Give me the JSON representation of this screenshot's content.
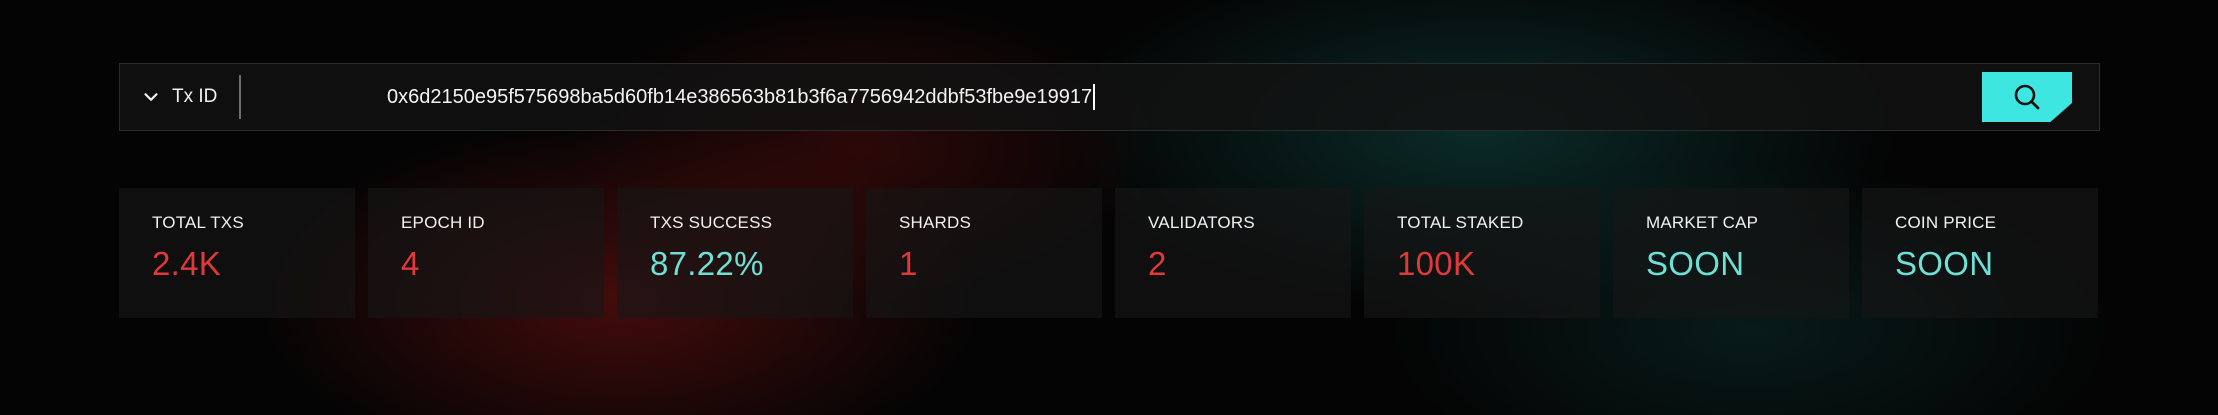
{
  "search": {
    "type_label": "Tx ID",
    "value": "0x6d2150e95f575698ba5d60fb14e386563b81b3f6a7756942ddbf53fbe9e19917",
    "placeholder": ""
  },
  "colors": {
    "red": "#e0393b",
    "teal": "#6fe0d6",
    "accent": "#3ee6e1"
  },
  "stats": [
    {
      "label": "TOTAL TXS",
      "value": "2.4K",
      "color": "#e0393b"
    },
    {
      "label": "EPOCH ID",
      "value": "4",
      "color": "#e0393b"
    },
    {
      "label": "TXS SUCCESS",
      "value": "87.22%",
      "color": "#6fe0d6"
    },
    {
      "label": "SHARDS",
      "value": "1",
      "color": "#e0393b"
    },
    {
      "label": "VALIDATORS",
      "value": "2",
      "color": "#e0393b"
    },
    {
      "label": "TOTAL STAKED",
      "value": "100K",
      "color": "#e0393b"
    },
    {
      "label": "MARKET CAP",
      "value": "SOON",
      "color": "#6fe0d6"
    },
    {
      "label": "COIN PRICE",
      "value": "SOON",
      "color": "#6fe0d6"
    }
  ],
  "icons": {
    "dropdown": "chevron-down-icon",
    "search": "search-icon"
  }
}
